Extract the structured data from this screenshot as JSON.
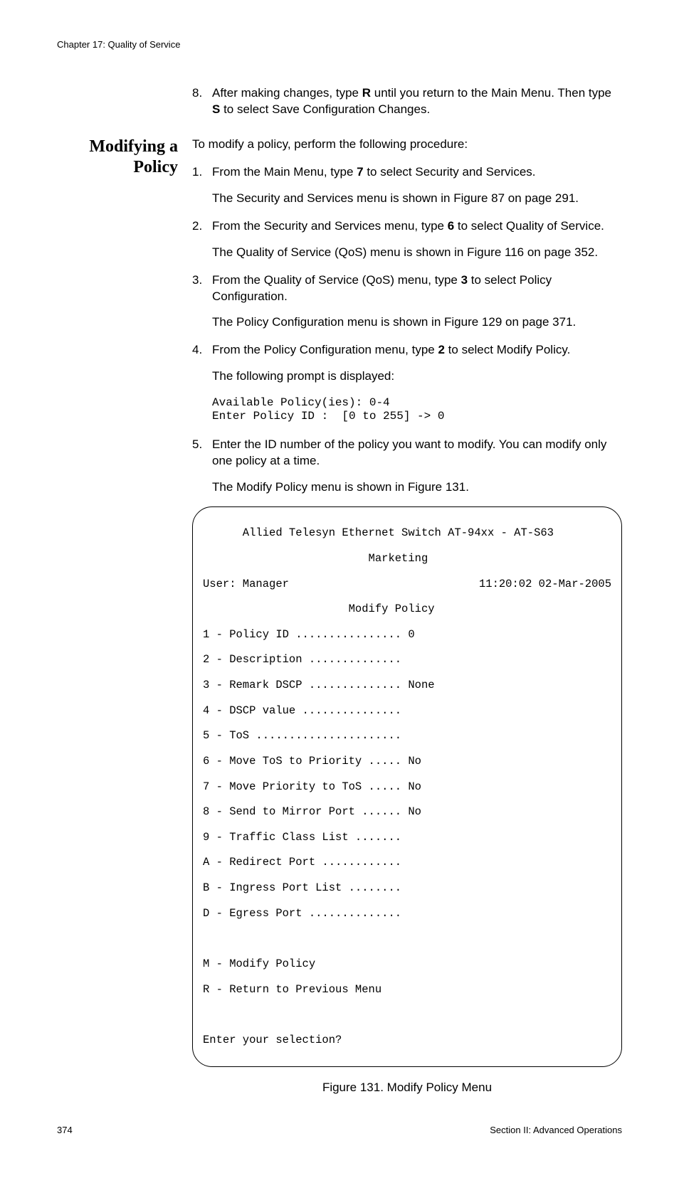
{
  "header": {
    "chapter": "Chapter 17: Quality of Service"
  },
  "prev_step": {
    "num": "8.",
    "t1": "After making changes, type ",
    "b1": "R",
    "t2": " until you return to the Main Menu. Then type ",
    "b2": "S",
    "t3": " to select Save Configuration Changes."
  },
  "section_title_l1": "Modifying a",
  "section_title_l2": "Policy",
  "intro": "To modify a policy, perform the following procedure:",
  "steps": {
    "s1": {
      "num": "1.",
      "t1": "From the Main Menu, type ",
      "b1": "7",
      "t2": " to select Security and Services.",
      "sub": "The Security and Services menu is shown in Figure 87 on page 291."
    },
    "s2": {
      "num": "2.",
      "t1": "From the Security and Services menu, type ",
      "b1": "6",
      "t2": " to select Quality of Service.",
      "sub": "The Quality of Service (QoS) menu is shown in Figure 116 on page 352."
    },
    "s3": {
      "num": "3.",
      "t1": "From the Quality of Service (QoS) menu, type ",
      "b1": "3",
      "t2": " to select Policy Configuration.",
      "sub": "The Policy Configuration menu is shown in Figure 129 on page 371."
    },
    "s4": {
      "num": "4.",
      "t1": "From the Policy Configuration menu, type ",
      "b1": "2",
      "t2": " to select Modify Policy.",
      "sub": "The following prompt is displayed:"
    },
    "prompt": "Available Policy(ies): 0-4\nEnter Policy ID :  [0 to 255] -> 0",
    "s5": {
      "num": "5.",
      "t1": "Enter the ID number of the policy you want to modify. You can modify only one policy at a time.",
      "sub": "The Modify Policy menu is shown in Figure 131."
    }
  },
  "menu": {
    "line1": "      Allied Telesyn Ethernet Switch AT-94xx - AT-S63",
    "line2": "                         Marketing",
    "user_line_left": "User: Manager",
    "user_line_right": "11:20:02 02-Mar-2005",
    "title": "                      Modify Policy",
    "items": [
      "1 - Policy ID ................ 0",
      "2 - Description ..............",
      "3 - Remark DSCP .............. None",
      "4 - DSCP value ...............",
      "5 - ToS ......................",
      "6 - Move ToS to Priority ..... No",
      "7 - Move Priority to ToS ..... No",
      "8 - Send to Mirror Port ...... No",
      "9 - Traffic Class List .......",
      "A - Redirect Port ............",
      "B - Ingress Port List ........",
      "D - Egress Port ..............",
      "",
      "M - Modify Policy",
      "R - Return to Previous Menu",
      "",
      "Enter your selection?"
    ]
  },
  "figure_caption": "Figure 131. Modify Policy Menu",
  "footer": {
    "page": "374",
    "section": "Section II: Advanced Operations"
  }
}
